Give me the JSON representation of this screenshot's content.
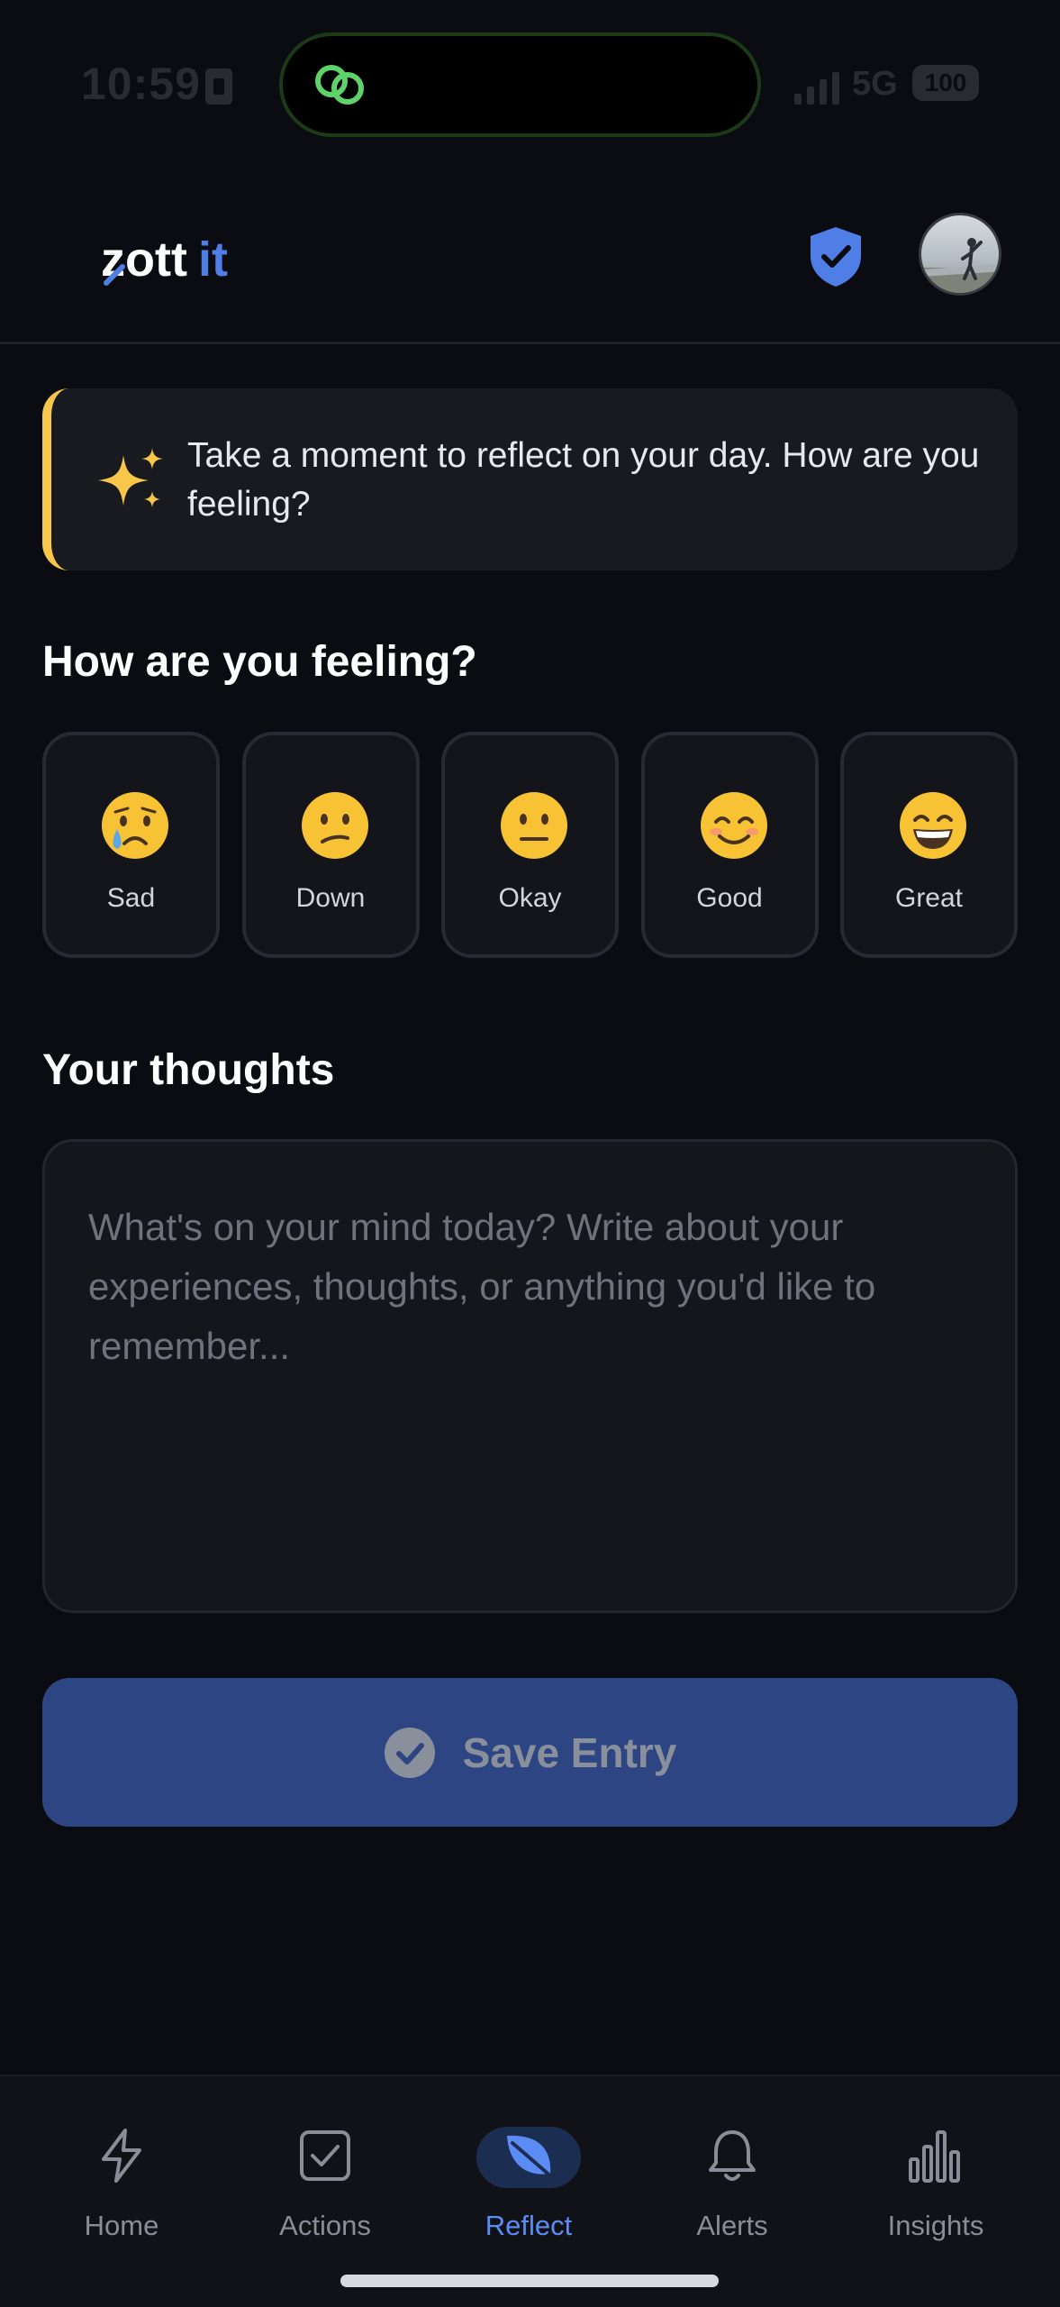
{
  "status_bar": {
    "time": "10:59",
    "network": "5G",
    "battery": "100"
  },
  "header": {
    "logo_text": "zottit",
    "shield_icon": "shield-check-icon",
    "avatar_icon": "profile-avatar"
  },
  "banner": {
    "icon": "sparkles-icon",
    "text": "Take a moment to reflect on your day. How are you feeling?"
  },
  "feelings": {
    "title": "How are you feeling?",
    "options": [
      {
        "label": "Sad",
        "icon": "crying-face"
      },
      {
        "label": "Down",
        "icon": "confused-face"
      },
      {
        "label": "Okay",
        "icon": "neutral-face"
      },
      {
        "label": "Good",
        "icon": "smiling-face"
      },
      {
        "label": "Great",
        "icon": "grinning-face"
      }
    ]
  },
  "thoughts": {
    "title": "Your thoughts",
    "value": "",
    "placeholder": "What's on your mind today? Write about your experiences, thoughts, or anything you'd like to remember..."
  },
  "save": {
    "label": "Save Entry",
    "state": "disabled"
  },
  "nav": {
    "items": [
      {
        "label": "Home",
        "icon": "lightning-icon"
      },
      {
        "label": "Actions",
        "icon": "checkbox-icon"
      },
      {
        "label": "Reflect",
        "icon": "leaf-icon",
        "active": true
      },
      {
        "label": "Alerts",
        "icon": "bell-icon"
      },
      {
        "label": "Insights",
        "icon": "bar-chart-icon"
      }
    ]
  },
  "colors": {
    "background": "#0b0c11",
    "accent": "#4f7fe6",
    "banner_accent": "#f7c64b",
    "button": "#2d4683"
  }
}
